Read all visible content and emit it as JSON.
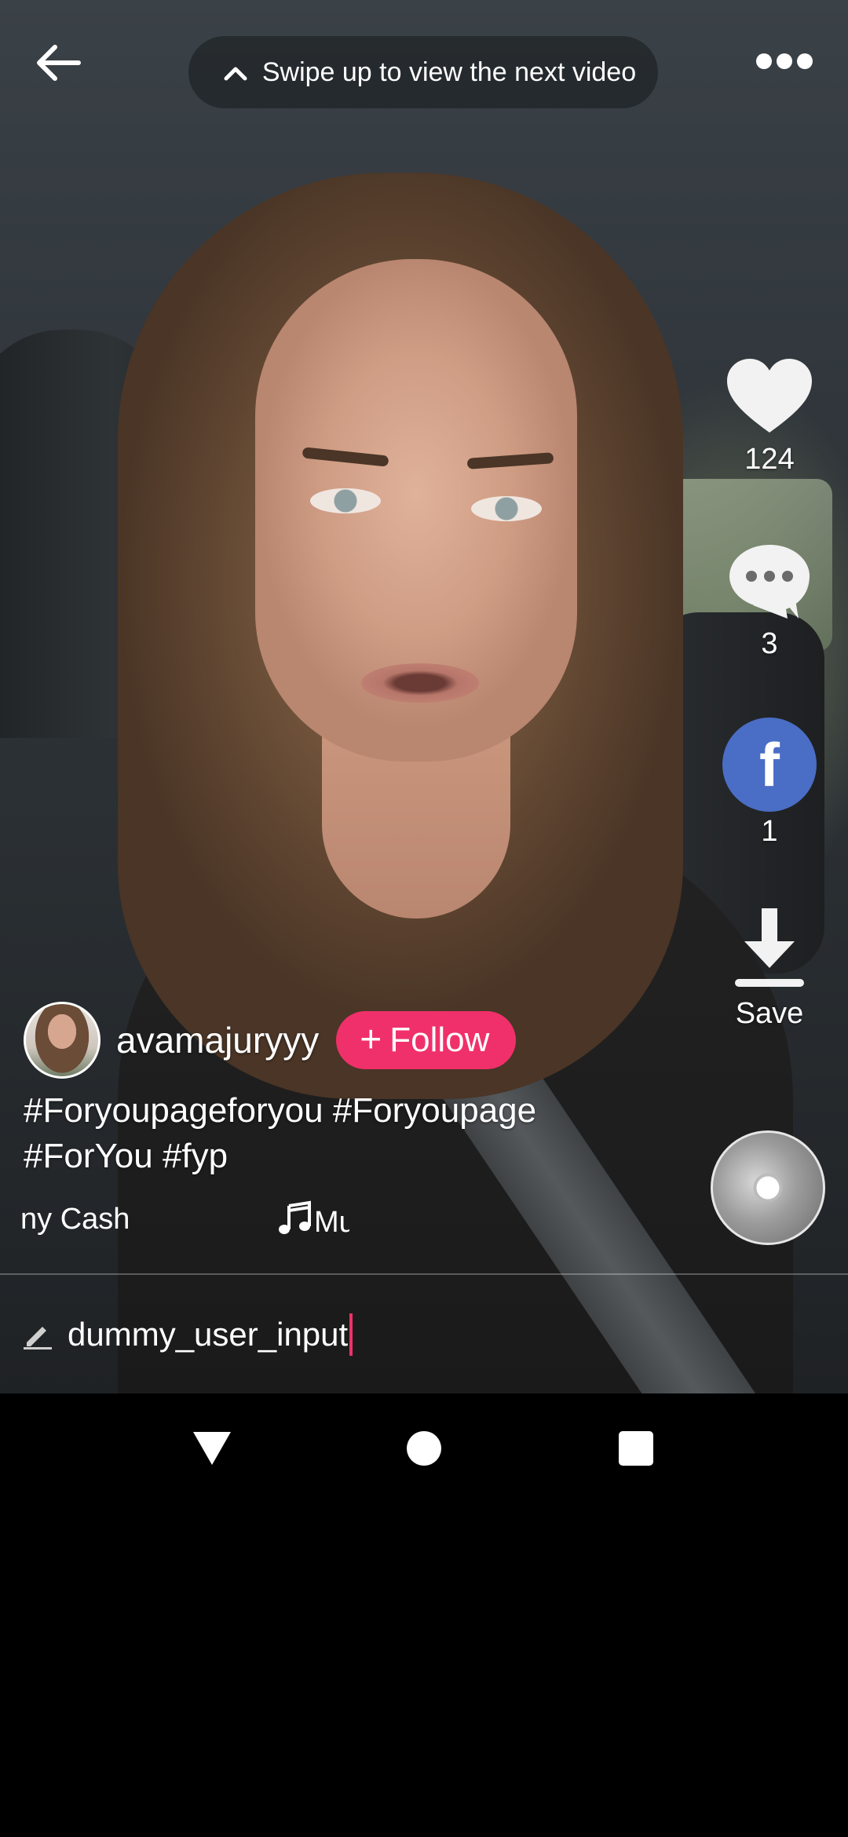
{
  "top_bar": {
    "hint_text": "Swipe up to view the next video",
    "back_icon": "arrow-left-icon",
    "more_icon": "more-horizontal-icon"
  },
  "actions": {
    "likes": "124",
    "comments": "3",
    "shares": "1",
    "share_glyph": "f",
    "save_label": "Save"
  },
  "author": {
    "username": "avamajuryyy",
    "follow_plus": "+",
    "follow_label": "Follow"
  },
  "caption": {
    "line1": "#Foryoupageforyou #Foryoupage",
    "line2": "#ForYou #fyp"
  },
  "music": {
    "marquee_left": "ny Cash",
    "marquee_right": "Mu"
  },
  "comment": {
    "input_value": "dummy_user_input"
  },
  "colors": {
    "accent_pink": "#f0306a",
    "facebook_blue": "#4a6dc5",
    "nav_background": "#000000"
  }
}
